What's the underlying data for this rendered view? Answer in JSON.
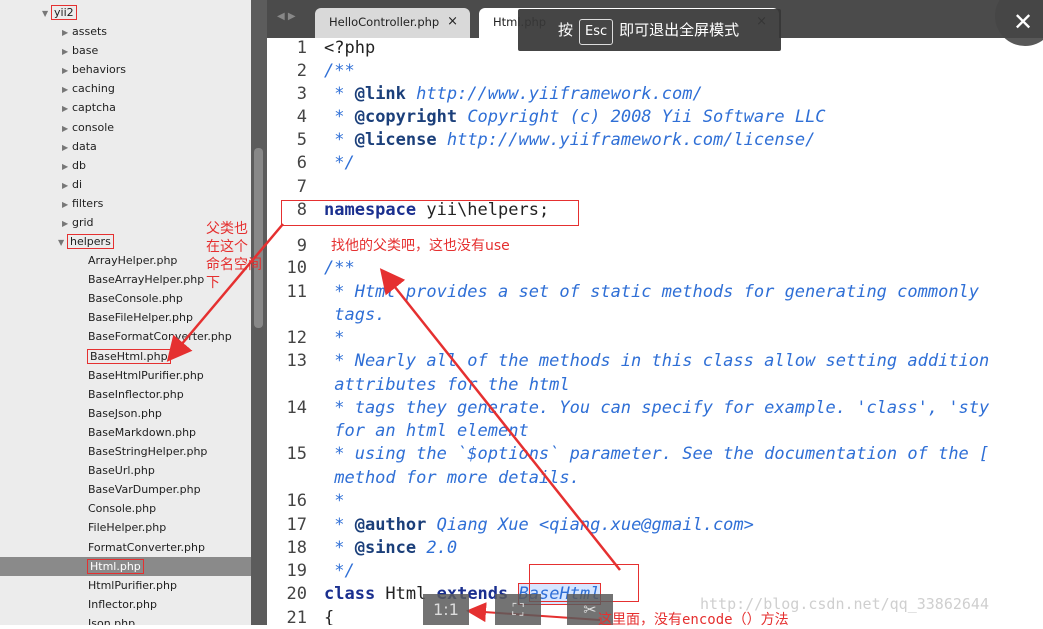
{
  "sidebar": {
    "root": "yii2",
    "folders": [
      "assets",
      "base",
      "behaviors",
      "caching",
      "captcha",
      "console",
      "data",
      "db",
      "di",
      "filters",
      "grid"
    ],
    "open_folder": "helpers",
    "files": [
      "ArrayHelper.php",
      "BaseArrayHelper.php",
      "BaseConsole.php",
      "BaseFileHelper.php",
      "BaseFormatConverter.php",
      "BaseHtml.php",
      "BaseHtmlPurifier.php",
      "BaseInflector.php",
      "BaseJson.php",
      "BaseMarkdown.php",
      "BaseStringHelper.php",
      "BaseUrl.php",
      "BaseVarDumper.php",
      "Console.php",
      "FileHelper.php",
      "FormatConverter.php",
      "Html.php",
      "HtmlPurifier.php",
      "Inflector.php",
      "Json.php"
    ]
  },
  "tabs": [
    {
      "label": "HelloController.php",
      "close": "×"
    },
    {
      "label": "Html.php",
      "close": "×"
    }
  ],
  "tab_nav": "◀ ▶",
  "toast": {
    "before": "按",
    "key": "Esc",
    "after": "即可退出全屏模式"
  },
  "close_label": "✕",
  "editor": {
    "line_numbers": [
      "1",
      "2",
      "3",
      "4",
      "5",
      "6",
      "7",
      "8",
      "9",
      "10",
      "11",
      "",
      "12",
      "13",
      "",
      "14",
      "",
      "15",
      "",
      "16",
      "17",
      "18",
      "19",
      "20",
      "21"
    ],
    "lines": {
      "l1": "<?php",
      "l2": "/**",
      "l3a": " * ",
      "l3b": "@link",
      "l3c": " http://www.yiiframework.com/",
      "l4a": " * ",
      "l4b": "@copyright",
      "l4c": " Copyright (c) 2008 Yii Software LLC",
      "l5a": " * ",
      "l5b": "@license",
      "l5c": " http://www.yiiframework.com/license/",
      "l6": " */",
      "l8a": "namespace",
      "l8b": " yii\\helpers;",
      "l10": "/**",
      "l11": " * Html provides a set of static methods for generating commonly",
      "l11b": " tags.",
      "l12": " *",
      "l13": " * Nearly all of the methods in this class allow setting addition",
      "l13b": " attributes for the html",
      "l14": " * tags they generate. You can specify for example. 'class', 'sty",
      "l14b": " for an html element",
      "l15": " * using the `$options` parameter. See the documentation of the [",
      "l15b": " method for more details.",
      "l16": " *",
      "l17a": " * ",
      "l17b": "@author",
      "l17c": " Qiang Xue <qiang.xue@gmail.com>",
      "l18a": " * ",
      "l18b": "@since",
      "l18c": " 2.0",
      "l19": " */",
      "l20a": "class",
      "l20b": " Html ",
      "l20c": "extends",
      "l20d": " ",
      "l20e": "BaseHtml",
      "l21": "{"
    }
  },
  "annotations": {
    "parent_ns": [
      "父类也",
      "在这个",
      "命名空间",
      "下"
    ],
    "find_parent": "找他的父类吧，这也没有use",
    "no_encode_a": "这里面，没有",
    "no_encode_b": "encode",
    "no_encode_c": "（）方法"
  },
  "bottom_bar": {
    "one_to_one": "1:1",
    "fit": "⛶",
    "screenshot": "✂"
  },
  "watermark": "http://blog.csdn.net/qq_33862644",
  "colors": {
    "annotation": "#e53030",
    "comment": "#2f6fd6",
    "keyword": "#1a2f8f"
  }
}
